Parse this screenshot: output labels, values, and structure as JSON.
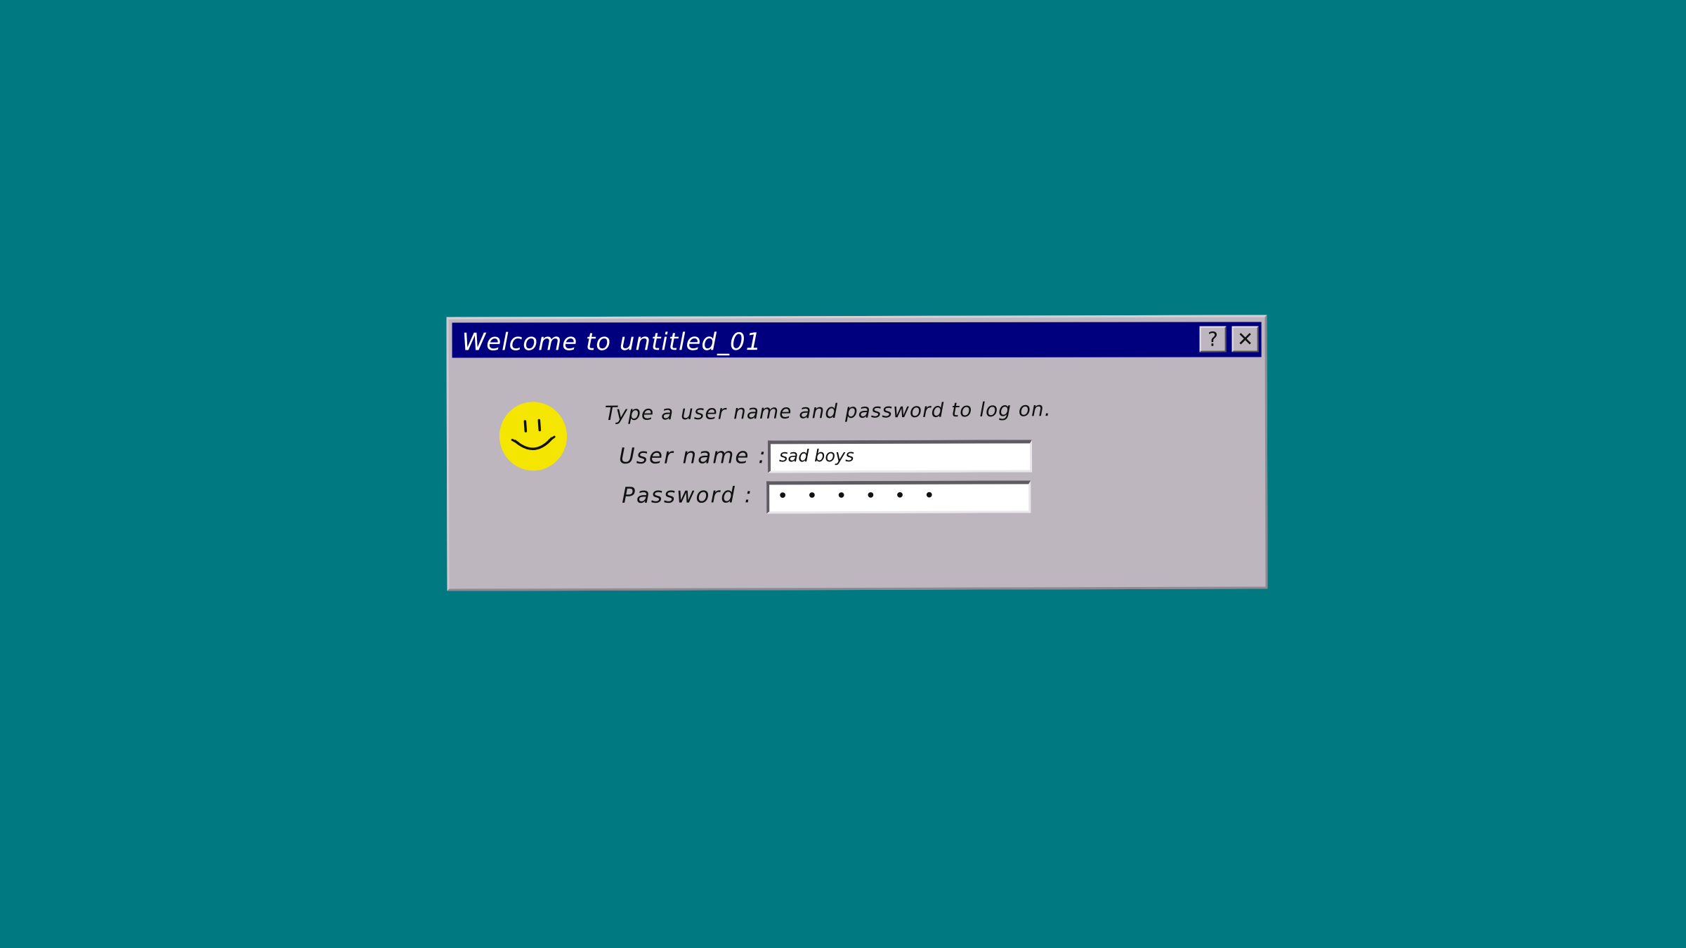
{
  "desktop": {
    "background_color": "#007a80"
  },
  "dialog": {
    "title": "Welcome to  untitled_01",
    "help_label": "?",
    "close_label": "✕",
    "instruction": "Type a user name and password to log on.",
    "username_label": "User name :",
    "username_value": "sad boys",
    "password_label": "Password :",
    "password_value": "• • • • • •",
    "colors": {
      "titlebar": "#00007f",
      "body": "#bdb6bf",
      "smiley": "#f4e600"
    },
    "icon": "smiley-face-icon"
  }
}
